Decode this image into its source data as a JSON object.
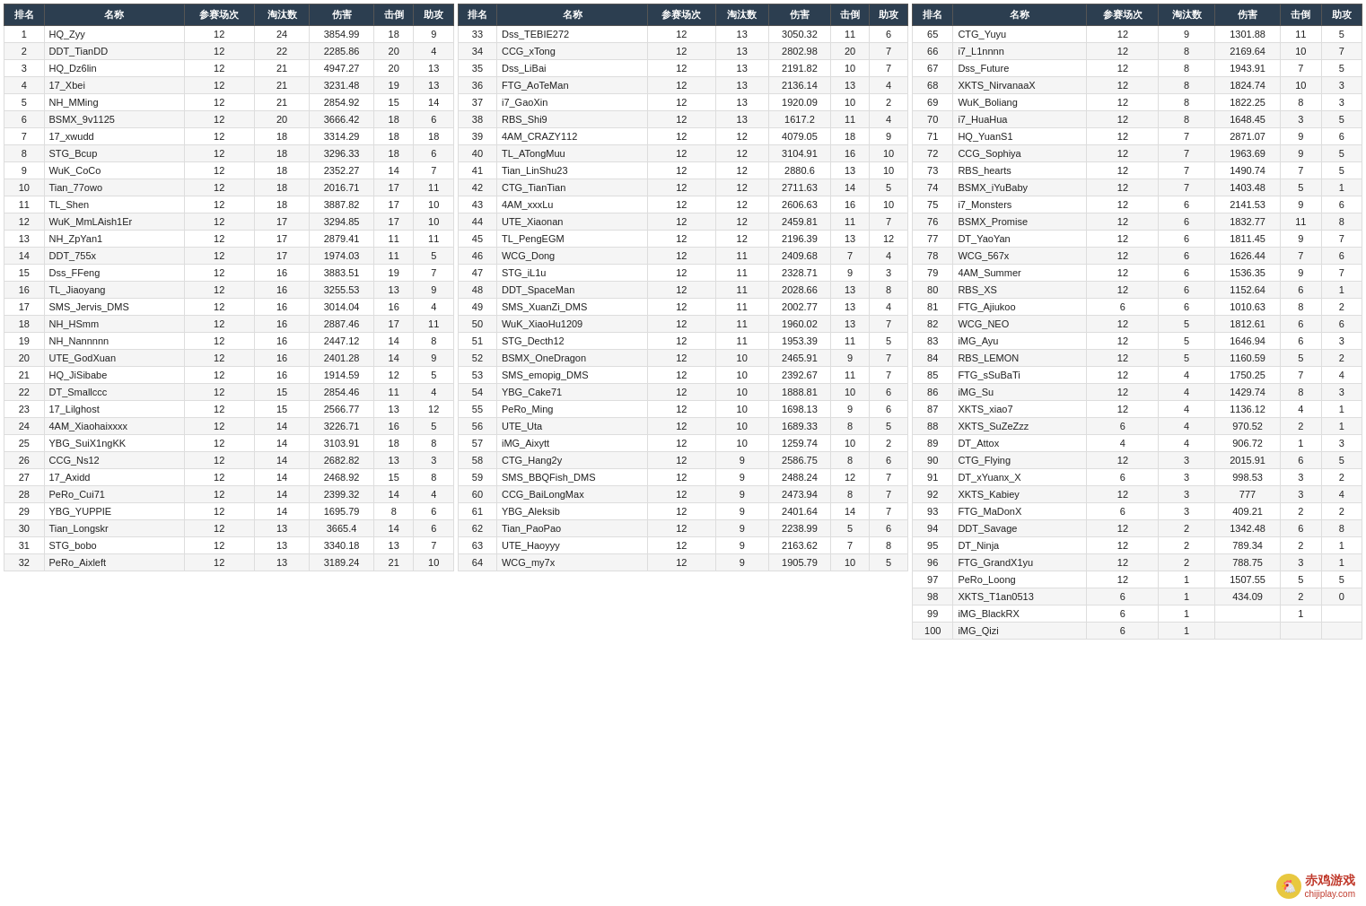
{
  "headers": {
    "rank": "排名",
    "name": "名称",
    "matches": "参赛场次",
    "elim": "淘汰数",
    "damage": "伤害",
    "kills": "击倒",
    "assists": "助攻"
  },
  "table1": [
    [
      1,
      "HQ_Zyy",
      12,
      24,
      "3854.99",
      18,
      9
    ],
    [
      2,
      "DDT_TianDD",
      12,
      22,
      "2285.86",
      20,
      4
    ],
    [
      3,
      "HQ_Dz6lin",
      12,
      21,
      "4947.27",
      20,
      13
    ],
    [
      4,
      "17_Xbei",
      12,
      21,
      "3231.48",
      19,
      13
    ],
    [
      5,
      "NH_MMing",
      12,
      21,
      "2854.92",
      15,
      14
    ],
    [
      6,
      "BSMX_9v1125",
      12,
      20,
      "3666.42",
      18,
      6
    ],
    [
      7,
      "17_xwudd",
      12,
      18,
      "3314.29",
      18,
      18
    ],
    [
      8,
      "STG_Bcup",
      12,
      18,
      "3296.33",
      18,
      6
    ],
    [
      9,
      "WuK_CoCo",
      12,
      18,
      "2352.27",
      14,
      7
    ],
    [
      10,
      "Tian_77owo",
      12,
      18,
      "2016.71",
      17,
      11
    ],
    [
      11,
      "TL_Shen",
      12,
      18,
      "3887.82",
      17,
      10
    ],
    [
      12,
      "WuK_MmLAish1Er",
      12,
      17,
      "3294.85",
      17,
      10
    ],
    [
      13,
      "NH_ZpYan1",
      12,
      17,
      "2879.41",
      11,
      11
    ],
    [
      14,
      "DDT_755x",
      12,
      17,
      "1974.03",
      11,
      5
    ],
    [
      15,
      "Dss_FFeng",
      12,
      16,
      "3883.51",
      19,
      7
    ],
    [
      16,
      "TL_Jiaoyang",
      12,
      16,
      "3255.53",
      13,
      9
    ],
    [
      17,
      "SMS_Jervis_DMS",
      12,
      16,
      "3014.04",
      16,
      4
    ],
    [
      18,
      "NH_HSmm",
      12,
      16,
      "2887.46",
      17,
      11
    ],
    [
      19,
      "NH_Nannnnn",
      12,
      16,
      "2447.12",
      14,
      8
    ],
    [
      20,
      "UTE_GodXuan",
      12,
      16,
      "2401.28",
      14,
      9
    ],
    [
      21,
      "HQ_JiSibabe",
      12,
      16,
      "1914.59",
      12,
      5
    ],
    [
      22,
      "DT_Smallccc",
      12,
      15,
      "2854.46",
      11,
      4
    ],
    [
      23,
      "17_Lilghost",
      12,
      15,
      "2566.77",
      13,
      12
    ],
    [
      24,
      "4AM_Xiaohaixxxx",
      12,
      14,
      "3226.71",
      16,
      5
    ],
    [
      25,
      "YBG_SuiX1ngKK",
      12,
      14,
      "3103.91",
      18,
      8
    ],
    [
      26,
      "CCG_Ns12",
      12,
      14,
      "2682.82",
      13,
      3
    ],
    [
      27,
      "17_Axidd",
      12,
      14,
      "2468.92",
      15,
      8
    ],
    [
      28,
      "PeRo_Cui71",
      12,
      14,
      "2399.32",
      14,
      4
    ],
    [
      29,
      "YBG_YUPPIE",
      12,
      14,
      "1695.79",
      8,
      6
    ],
    [
      30,
      "Tian_Longskr",
      12,
      13,
      "3665.4",
      14,
      6
    ],
    [
      31,
      "STG_bobo",
      12,
      13,
      "3340.18",
      13,
      7
    ],
    [
      32,
      "PeRo_Aixleft",
      12,
      13,
      "3189.24",
      21,
      10
    ]
  ],
  "table2": [
    [
      33,
      "Dss_TEBIE272",
      12,
      13,
      "3050.32",
      11,
      6
    ],
    [
      34,
      "CCG_xTong",
      12,
      13,
      "2802.98",
      20,
      7
    ],
    [
      35,
      "Dss_LiBai",
      12,
      13,
      "2191.82",
      10,
      7
    ],
    [
      36,
      "FTG_AoTeMan",
      12,
      13,
      "2136.14",
      13,
      4
    ],
    [
      37,
      "i7_GaoXin",
      12,
      13,
      "1920.09",
      10,
      2
    ],
    [
      38,
      "RBS_Shi9",
      12,
      13,
      "1617.2",
      11,
      4
    ],
    [
      39,
      "4AM_CRAZY112",
      12,
      12,
      "4079.05",
      18,
      9
    ],
    [
      40,
      "TL_ATongMuu",
      12,
      12,
      "3104.91",
      16,
      10
    ],
    [
      41,
      "Tian_LinShu23",
      12,
      12,
      "2880.6",
      13,
      10
    ],
    [
      42,
      "CTG_TianTian",
      12,
      12,
      "2711.63",
      14,
      5
    ],
    [
      43,
      "4AM_xxxLu",
      12,
      12,
      "2606.63",
      16,
      10
    ],
    [
      44,
      "UTE_Xiaonan",
      12,
      12,
      "2459.81",
      11,
      7
    ],
    [
      45,
      "TL_PengEGM",
      12,
      12,
      "2196.39",
      13,
      12
    ],
    [
      46,
      "WCG_Dong",
      12,
      11,
      "2409.68",
      7,
      4
    ],
    [
      47,
      "STG_iL1u",
      12,
      11,
      "2328.71",
      9,
      3
    ],
    [
      48,
      "DDT_SpaceMan",
      12,
      11,
      "2028.66",
      13,
      8
    ],
    [
      49,
      "SMS_XuanZi_DMS",
      12,
      11,
      "2002.77",
      13,
      4
    ],
    [
      50,
      "WuK_XiaoHu1209",
      12,
      11,
      "1960.02",
      13,
      7
    ],
    [
      51,
      "STG_Decth12",
      12,
      11,
      "1953.39",
      11,
      5
    ],
    [
      52,
      "BSMX_OneDragon",
      12,
      10,
      "2465.91",
      9,
      7
    ],
    [
      53,
      "SMS_emopig_DMS",
      12,
      10,
      "2392.67",
      11,
      7
    ],
    [
      54,
      "YBG_Cake71",
      12,
      10,
      "1888.81",
      10,
      6
    ],
    [
      55,
      "PeRo_Ming",
      12,
      10,
      "1698.13",
      9,
      6
    ],
    [
      56,
      "UTE_Uta",
      12,
      10,
      "1689.33",
      8,
      5
    ],
    [
      57,
      "iMG_Aixytt",
      12,
      10,
      "1259.74",
      10,
      2
    ],
    [
      58,
      "CTG_Hang2y",
      12,
      9,
      "2586.75",
      8,
      6
    ],
    [
      59,
      "SMS_BBQFish_DMS",
      12,
      9,
      "2488.24",
      12,
      7
    ],
    [
      60,
      "CCG_BaiLongMax",
      12,
      9,
      "2473.94",
      8,
      7
    ],
    [
      61,
      "YBG_Aleksib",
      12,
      9,
      "2401.64",
      14,
      7
    ],
    [
      62,
      "Tian_PaoPao",
      12,
      9,
      "2238.99",
      5,
      6
    ],
    [
      63,
      "UTE_Haoyyy",
      12,
      9,
      "2163.62",
      7,
      8
    ],
    [
      64,
      "WCG_my7x",
      12,
      9,
      "1905.79",
      10,
      5
    ]
  ],
  "table3": [
    [
      65,
      "CTG_Yuyu",
      12,
      9,
      "1301.88",
      11,
      5
    ],
    [
      66,
      "i7_L1nnnn",
      12,
      8,
      "2169.64",
      10,
      7
    ],
    [
      67,
      "Dss_Future",
      12,
      8,
      "1943.91",
      7,
      5
    ],
    [
      68,
      "XKTS_NirvanaaX",
      12,
      8,
      "1824.74",
      10,
      3
    ],
    [
      69,
      "WuK_Boliang",
      12,
      8,
      "1822.25",
      8,
      3
    ],
    [
      70,
      "i7_HuaHua",
      12,
      8,
      "1648.45",
      3,
      5
    ],
    [
      71,
      "HQ_YuanS1",
      12,
      7,
      "2871.07",
      9,
      6
    ],
    [
      72,
      "CCG_Sophiya",
      12,
      7,
      "1963.69",
      9,
      5
    ],
    [
      73,
      "RBS_hearts",
      12,
      7,
      "1490.74",
      7,
      5
    ],
    [
      74,
      "BSMX_iYuBaby",
      12,
      7,
      "1403.48",
      5,
      1
    ],
    [
      75,
      "i7_Monsters",
      12,
      6,
      "2141.53",
      9,
      6
    ],
    [
      76,
      "BSMX_Promise",
      12,
      6,
      "1832.77",
      11,
      8
    ],
    [
      77,
      "DT_YaoYan",
      12,
      6,
      "1811.45",
      9,
      7
    ],
    [
      78,
      "WCG_567x",
      12,
      6,
      "1626.44",
      7,
      6
    ],
    [
      79,
      "4AM_Summer",
      12,
      6,
      "1536.35",
      9,
      7
    ],
    [
      80,
      "RBS_XS",
      12,
      6,
      "1152.64",
      6,
      1
    ],
    [
      81,
      "FTG_Ajiukoo",
      6,
      6,
      "1010.63",
      8,
      2
    ],
    [
      82,
      "WCG_NEO",
      12,
      5,
      "1812.61",
      6,
      6
    ],
    [
      83,
      "iMG_Ayu",
      12,
      5,
      "1646.94",
      6,
      3
    ],
    [
      84,
      "RBS_LEMON",
      12,
      5,
      "1160.59",
      5,
      2
    ],
    [
      85,
      "FTG_sSuBaTi",
      12,
      4,
      "1750.25",
      7,
      4
    ],
    [
      86,
      "iMG_Su",
      12,
      4,
      "1429.74",
      8,
      3
    ],
    [
      87,
      "XKTS_xiao7",
      12,
      4,
      "1136.12",
      4,
      1
    ],
    [
      88,
      "XKTS_SuZeZzz",
      6,
      4,
      "970.52",
      2,
      1
    ],
    [
      89,
      "DT_Attox",
      4,
      4,
      "906.72",
      1,
      3
    ],
    [
      90,
      "CTG_Flying",
      12,
      3,
      "2015.91",
      6,
      5
    ],
    [
      91,
      "DT_xYuanx_X",
      6,
      3,
      "998.53",
      3,
      2
    ],
    [
      92,
      "XKTS_Kabiey",
      12,
      3,
      "777",
      3,
      4
    ],
    [
      93,
      "FTG_MaDonX",
      6,
      3,
      "409.21",
      2,
      2
    ],
    [
      94,
      "DDT_Savage",
      12,
      2,
      "1342.48",
      6,
      8
    ],
    [
      95,
      "DT_Ninja",
      12,
      2,
      "789.34",
      2,
      1
    ],
    [
      96,
      "FTG_GrandX1yu",
      12,
      2,
      "788.75",
      3,
      1
    ],
    [
      97,
      "PeRo_Loong",
      12,
      1,
      "1507.55",
      5,
      5
    ],
    [
      98,
      "XKTS_T1an0513",
      6,
      1,
      "434.09",
      2,
      0
    ],
    [
      99,
      "iMG_BlackRX",
      6,
      1,
      "",
      1,
      ""
    ],
    [
      100,
      "iMG_Qizi",
      6,
      1,
      "",
      "",
      ""
    ]
  ],
  "footer": {
    "logo_text": "赤鸡游戏",
    "logo_sub": "chijiplay.com",
    "logo_icon": "🐔"
  }
}
